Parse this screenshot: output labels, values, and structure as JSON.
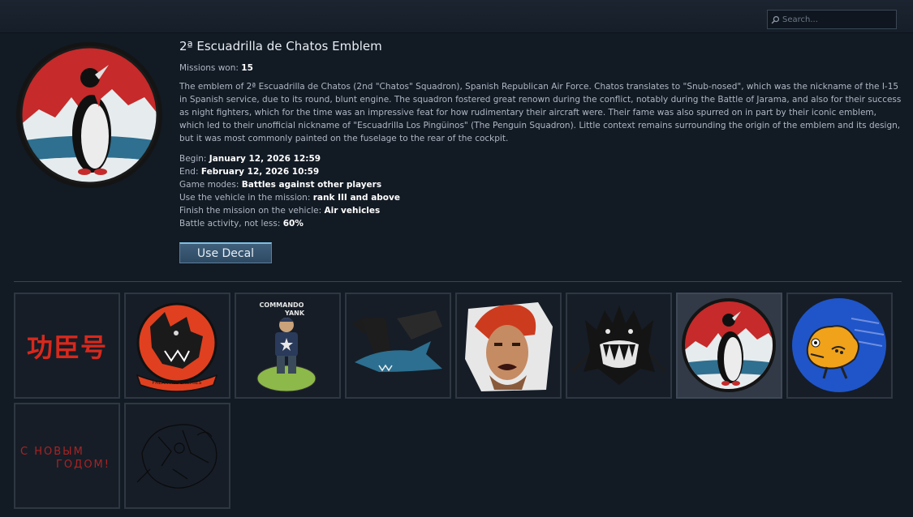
{
  "search": {
    "placeholder": "Search..."
  },
  "decal": {
    "title": "2ª Escuadrilla de Chatos Emblem",
    "missions_won_label": "Missions won:",
    "missions_won_value": "15",
    "description": "The emblem of 2ª Escuadrilla de Chatos (2nd \"Chatos\" Squadron), Spanish Republican Air Force. Chatos translates to \"Snub-nosed\", which was the nickname of the I-15 in Spanish service, due to its round, blunt engine. The squadron fostered great renown during the conflict, notably during the Battle of Jarama, and also for their success as night fighters, which for the time was an impressive feat for how rudimentary their aircraft were. Their fame was also spurred on in part by their iconic emblem, which led to their unofficial nickname of \"Escuadrilla Los Pingüinos\" (The Penguin Squadron). Little context remains surrounding the origin of the emblem and its design, but it was most commonly painted on the fuselage to the rear of the cockpit.",
    "begin_label": "Begin:",
    "begin_value": "January 12, 2026 12:59",
    "end_label": "End:",
    "end_value": "February 12, 2026 10:59",
    "game_modes_label": "Game modes:",
    "game_modes_value": "Battles against other players",
    "vehicle_label": "Use the vehicle in the mission:",
    "vehicle_value": "rank III and above",
    "finish_label": "Finish the mission on the vehicle:",
    "finish_value": "Air vehicles",
    "activity_label": "Battle activity, not less:",
    "activity_value": "60%",
    "use_button": "Use Decal"
  },
  "decals": {
    "chinese_text": "功臣号",
    "panther_ring_text": "FREAK ALL ENEMIES",
    "yank_top": "COMMANDO",
    "yank_bottom": "YANK",
    "russian_line1": "С НОВЫМ",
    "russian_line2": "ГОДОМ!"
  },
  "colors": {
    "accent": "#7cc0e4",
    "penguin_red": "#c62a2a",
    "sky_blue": "#2f6f8f",
    "dog_blue": "#1f55c8"
  },
  "icons": {
    "search": "magnifier-icon"
  }
}
